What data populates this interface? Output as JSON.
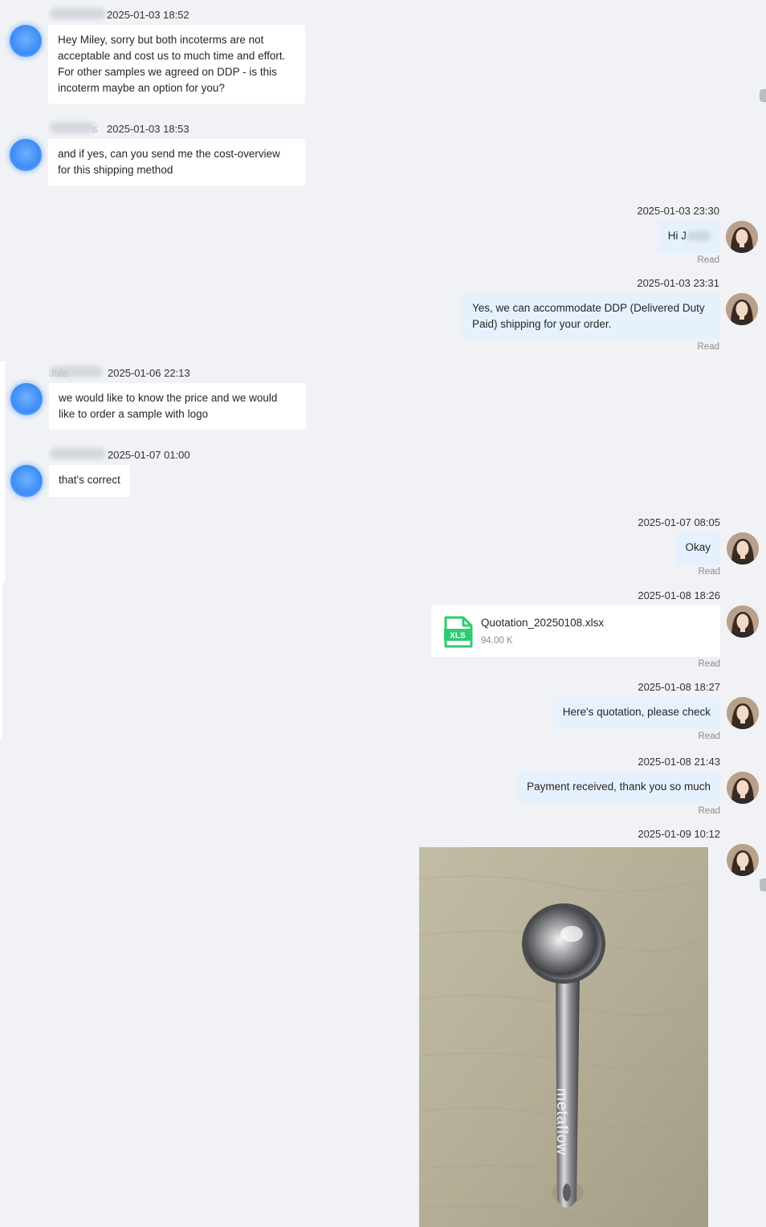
{
  "messages": [
    {
      "id": 1,
      "direction": "incoming",
      "time": "2025-01-03 18:52",
      "lines": [
        "Hey Miley, sorry but both incoterms are not",
        "acceptable and cost us to much time and effort.",
        "For other samples we agreed on DDP - is this",
        "incoterm maybe an option for you?"
      ]
    },
    {
      "id": 2,
      "direction": "incoming",
      "name_fragment": "s",
      "time": "2025-01-03 18:53",
      "lines": [
        "and if yes, can you send me the cost-overview",
        "for this shipping method"
      ]
    },
    {
      "id": 3,
      "direction": "outgoing",
      "time": "2025-01-03 23:30",
      "text": "Hi J",
      "status": "Read"
    },
    {
      "id": 4,
      "direction": "outgoing",
      "time": "2025-01-03 23:31",
      "lines": [
        "Yes, we can accommodate DDP (Delivered Duty",
        "Paid) shipping for your order."
      ],
      "status": "Read"
    },
    {
      "id": 5,
      "direction": "incoming",
      "name_fragment": "Jule",
      "time": "2025-01-06 22:13",
      "lines": [
        "we would like to know the price and we would",
        "like to order a sample with logo"
      ]
    },
    {
      "id": 6,
      "direction": "incoming",
      "time": "2025-01-07 01:00",
      "text": "that's correct"
    },
    {
      "id": 7,
      "direction": "outgoing",
      "time": "2025-01-07 08:05",
      "text": "Okay",
      "status": "Read"
    },
    {
      "id": 8,
      "direction": "outgoing",
      "time": "2025-01-08 18:26",
      "file": {
        "name": "Quotation_20250108.xlsx",
        "size": "94.00 K",
        "icon_label": "XLS",
        "icon": "xls-file-icon"
      },
      "status": "Read"
    },
    {
      "id": 9,
      "direction": "outgoing",
      "time": "2025-01-08 18:27",
      "text": "Here's quotation, please check",
      "status": "Read"
    },
    {
      "id": 10,
      "direction": "outgoing",
      "time": "2025-01-08 21:43",
      "text": "Payment received, thank you so much",
      "status": "Read"
    },
    {
      "id": 11,
      "direction": "outgoing",
      "time": "2025-01-09 10:12",
      "image": {
        "engraving": "metaflow"
      }
    }
  ],
  "colors": {
    "background": "#f0f2f5",
    "incoming_bubble": "#ffffff",
    "outgoing_bubble": "#e6f1fe",
    "read_status": "#8c8c8c",
    "xls_icon": "#2ecc71"
  }
}
